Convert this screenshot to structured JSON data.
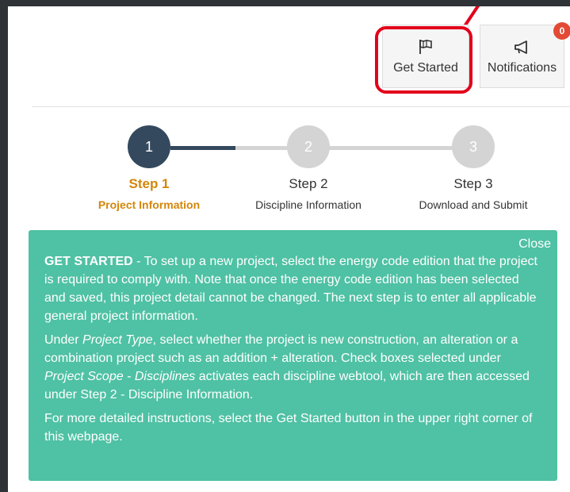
{
  "toolbar": {
    "get_started_label": "Get Started",
    "notifications_label": "Notifications",
    "notifications_count": "0",
    "get_started_icon": "flag-icon",
    "notifications_icon": "megaphone-icon",
    "highlight_color": "#e3001b"
  },
  "steps": [
    {
      "number": "1",
      "title": "Step 1",
      "subtitle": "Project Information",
      "state": "active"
    },
    {
      "number": "2",
      "title": "Step 2",
      "subtitle": "Discipline Information",
      "state": "pending"
    },
    {
      "number": "3",
      "title": "Step 3",
      "subtitle": "Download and Submit",
      "state": "pending"
    }
  ],
  "info_panel": {
    "close_label": "Close",
    "p1_strong": "GET STARTED",
    "p1_text": " - To set up a new project, select the energy code edition that the project is required to comply with. Note that once the energy code edition has been selected and saved, this project detail cannot be changed. The next step is to enter all applicable general project information.",
    "p2_a": "Under ",
    "p2_em1": "Project Type",
    "p2_b": ", select whether the project is new construction, an alteration or a combination project such as an addition + alteration. Check boxes selected under ",
    "p2_em2": "Project Scope - Disciplines",
    "p2_c": " activates each discipline webtool, which are then accessed under Step 2 - Discipline Information.",
    "p3": "For more detailed instructions, select the Get Started button in the upper right corner of this webpage."
  },
  "colors": {
    "active_step": "#34495e",
    "active_text": "#d4860b",
    "pending_step": "#d4d4d4",
    "info_bg": "#4fc1a4"
  }
}
